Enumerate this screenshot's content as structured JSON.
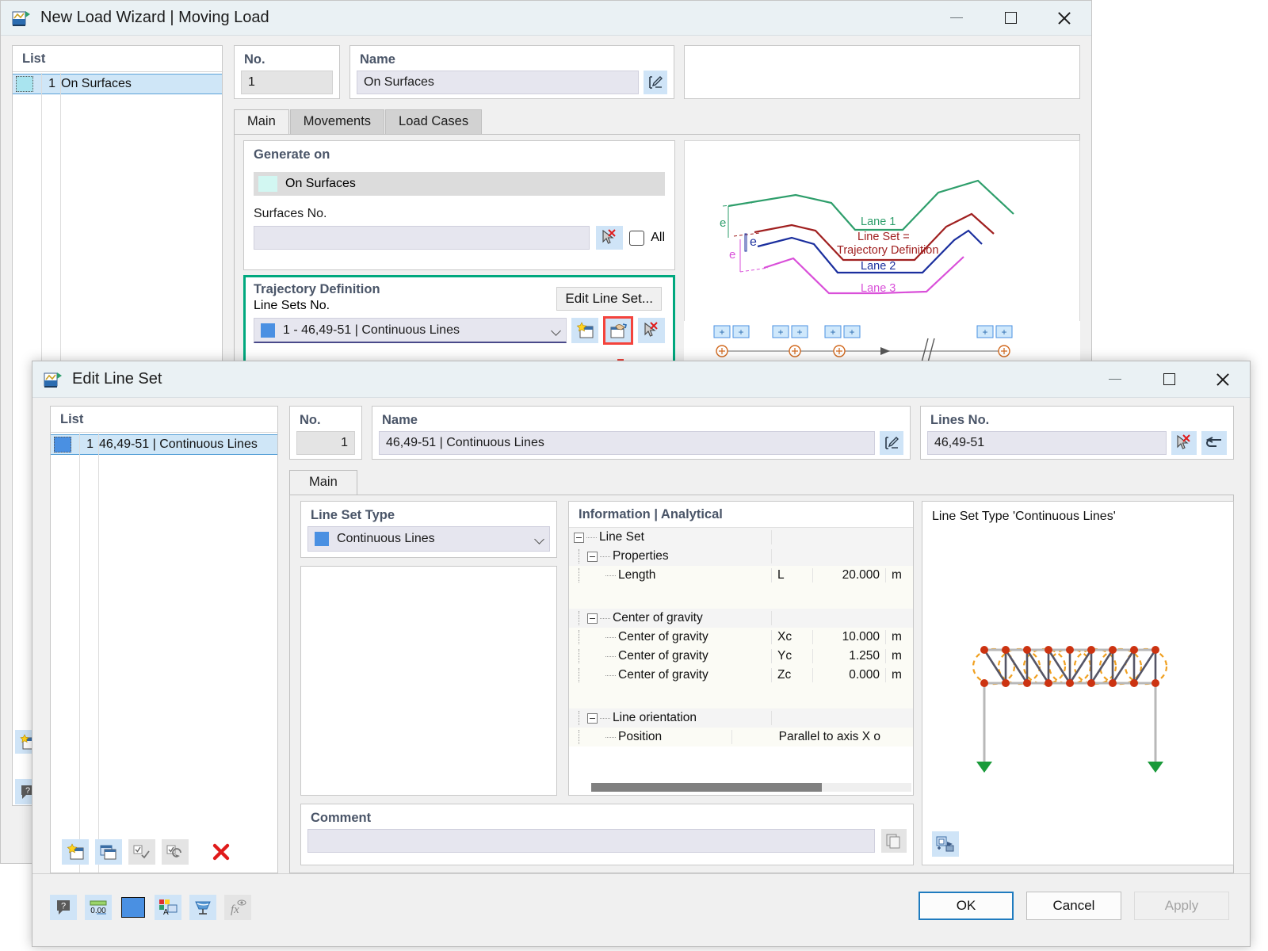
{
  "wizard": {
    "title": "New Load Wizard | Moving Load",
    "icon": "app-logo-icon",
    "list": {
      "header": "List",
      "rows": [
        {
          "num": "1",
          "label": "On Surfaces",
          "color": "#a9e4ef"
        }
      ]
    },
    "no": {
      "label": "No.",
      "value": "1"
    },
    "name": {
      "label": "Name",
      "value": "On Surfaces"
    },
    "tabs": [
      {
        "label": "Main",
        "active": true
      },
      {
        "label": "Movements",
        "active": false
      },
      {
        "label": "Load Cases",
        "active": false
      }
    ],
    "generate_on": {
      "label": "Generate on",
      "selected": "On Surfaces",
      "surfaces_label": "Surfaces No.",
      "surfaces_value": "",
      "all_label": "All",
      "all_checked": false
    },
    "trajectory": {
      "label": "Trajectory Definition",
      "line_sets_label": "Line Sets No.",
      "edit_button": "Edit Line Set...",
      "selected": "1 - 46,49-51 | Continuous Lines"
    },
    "diagram": {
      "lane1": "Lane 1",
      "lane2": "Lane 2",
      "lane3": "Lane 3",
      "annotation_line1": "Line Set =",
      "annotation_line2": "Trajectory Definition",
      "e_top": "e",
      "e_mid": "e",
      "e_bottom": "e"
    },
    "window_controls": {
      "minimize": "minimize-icon",
      "maximize": "maximize-icon",
      "close": "close-icon"
    }
  },
  "lineset": {
    "title": "Edit Line Set",
    "icon": "app-logo-icon",
    "list": {
      "header": "List",
      "rows": [
        {
          "num": "1",
          "label": "46,49-51 | Continuous Lines",
          "color": "#4a90e2"
        }
      ]
    },
    "no": {
      "label": "No.",
      "value": "1"
    },
    "name": {
      "label": "Name",
      "value": "46,49-51 | Continuous Lines"
    },
    "lines_no": {
      "label": "Lines No.",
      "value": "46,49-51"
    },
    "tabs": [
      {
        "label": "Main",
        "active": true
      }
    ],
    "line_set_type": {
      "label": "Line Set Type",
      "selected": "Continuous Lines",
      "swatch": "#4a90e2"
    },
    "information": {
      "label": "Information | Analytical",
      "rows": [
        {
          "kind": "group",
          "indent": 0,
          "name": "Line Set",
          "symbol": "",
          "value": "",
          "unit": ""
        },
        {
          "kind": "group",
          "indent": 1,
          "name": "Properties",
          "symbol": "",
          "value": "",
          "unit": ""
        },
        {
          "kind": "value",
          "indent": 2,
          "name": "Length",
          "symbol": "L",
          "value": "20.000",
          "unit": "m"
        },
        {
          "kind": "spacer",
          "indent": 1,
          "name": "",
          "symbol": "",
          "value": "",
          "unit": ""
        },
        {
          "kind": "group",
          "indent": 1,
          "name": "Center of gravity",
          "symbol": "",
          "value": "",
          "unit": ""
        },
        {
          "kind": "value",
          "indent": 2,
          "name": "Center of gravity",
          "symbol": "Xc",
          "value": "10.000",
          "unit": "m"
        },
        {
          "kind": "value",
          "indent": 2,
          "name": "Center of gravity",
          "symbol": "Yc",
          "value": "1.250",
          "unit": "m"
        },
        {
          "kind": "value",
          "indent": 2,
          "name": "Center of gravity",
          "symbol": "Zc",
          "value": "0.000",
          "unit": "m"
        },
        {
          "kind": "spacer",
          "indent": 1,
          "name": "",
          "symbol": "",
          "value": "",
          "unit": ""
        },
        {
          "kind": "group",
          "indent": 1,
          "name": "Line orientation",
          "symbol": "",
          "value": "",
          "unit": ""
        },
        {
          "kind": "value",
          "indent": 2,
          "name": "Position",
          "symbol": "",
          "value": "Parallel to axis X o",
          "unit": ""
        }
      ]
    },
    "preview": {
      "caption": "Line Set Type 'Continuous Lines'"
    },
    "comment": {
      "label": "Comment",
      "value": ""
    },
    "footer_buttons": [
      {
        "label": "OK",
        "style": "primary"
      },
      {
        "label": "Cancel",
        "style": "normal"
      },
      {
        "label": "Apply",
        "style": "disabled"
      }
    ],
    "window_controls": {
      "minimize": "minimize-icon",
      "maximize": "maximize-icon",
      "close": "close-icon"
    }
  },
  "colors": {
    "accent_blue": "#4a90e2",
    "highlight_green": "#00a87e",
    "highlight_red": "#f4433c",
    "lane1": "#2e9e6b",
    "lane2": "#1b2f9e",
    "lane3": "#d94fd9",
    "trajectory": "#a02020",
    "header_text": "#4a5568"
  }
}
